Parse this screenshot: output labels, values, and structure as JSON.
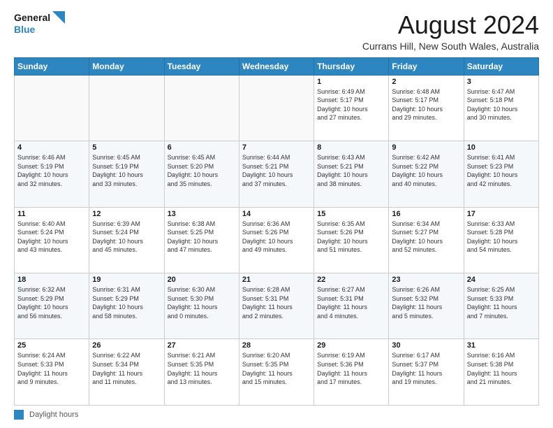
{
  "logo": {
    "line1": "General",
    "line2": "Blue"
  },
  "title": "August 2024",
  "subtitle": "Currans Hill, New South Wales, Australia",
  "days_of_week": [
    "Sunday",
    "Monday",
    "Tuesday",
    "Wednesday",
    "Thursday",
    "Friday",
    "Saturday"
  ],
  "footer": {
    "label": "Daylight hours"
  },
  "weeks": [
    [
      {
        "day": "",
        "info": ""
      },
      {
        "day": "",
        "info": ""
      },
      {
        "day": "",
        "info": ""
      },
      {
        "day": "",
        "info": ""
      },
      {
        "day": "1",
        "info": "Sunrise: 6:49 AM\nSunset: 5:17 PM\nDaylight: 10 hours\nand 27 minutes."
      },
      {
        "day": "2",
        "info": "Sunrise: 6:48 AM\nSunset: 5:17 PM\nDaylight: 10 hours\nand 29 minutes."
      },
      {
        "day": "3",
        "info": "Sunrise: 6:47 AM\nSunset: 5:18 PM\nDaylight: 10 hours\nand 30 minutes."
      }
    ],
    [
      {
        "day": "4",
        "info": "Sunrise: 6:46 AM\nSunset: 5:19 PM\nDaylight: 10 hours\nand 32 minutes."
      },
      {
        "day": "5",
        "info": "Sunrise: 6:45 AM\nSunset: 5:19 PM\nDaylight: 10 hours\nand 33 minutes."
      },
      {
        "day": "6",
        "info": "Sunrise: 6:45 AM\nSunset: 5:20 PM\nDaylight: 10 hours\nand 35 minutes."
      },
      {
        "day": "7",
        "info": "Sunrise: 6:44 AM\nSunset: 5:21 PM\nDaylight: 10 hours\nand 37 minutes."
      },
      {
        "day": "8",
        "info": "Sunrise: 6:43 AM\nSunset: 5:21 PM\nDaylight: 10 hours\nand 38 minutes."
      },
      {
        "day": "9",
        "info": "Sunrise: 6:42 AM\nSunset: 5:22 PM\nDaylight: 10 hours\nand 40 minutes."
      },
      {
        "day": "10",
        "info": "Sunrise: 6:41 AM\nSunset: 5:23 PM\nDaylight: 10 hours\nand 42 minutes."
      }
    ],
    [
      {
        "day": "11",
        "info": "Sunrise: 6:40 AM\nSunset: 5:24 PM\nDaylight: 10 hours\nand 43 minutes."
      },
      {
        "day": "12",
        "info": "Sunrise: 6:39 AM\nSunset: 5:24 PM\nDaylight: 10 hours\nand 45 minutes."
      },
      {
        "day": "13",
        "info": "Sunrise: 6:38 AM\nSunset: 5:25 PM\nDaylight: 10 hours\nand 47 minutes."
      },
      {
        "day": "14",
        "info": "Sunrise: 6:36 AM\nSunset: 5:26 PM\nDaylight: 10 hours\nand 49 minutes."
      },
      {
        "day": "15",
        "info": "Sunrise: 6:35 AM\nSunset: 5:26 PM\nDaylight: 10 hours\nand 51 minutes."
      },
      {
        "day": "16",
        "info": "Sunrise: 6:34 AM\nSunset: 5:27 PM\nDaylight: 10 hours\nand 52 minutes."
      },
      {
        "day": "17",
        "info": "Sunrise: 6:33 AM\nSunset: 5:28 PM\nDaylight: 10 hours\nand 54 minutes."
      }
    ],
    [
      {
        "day": "18",
        "info": "Sunrise: 6:32 AM\nSunset: 5:29 PM\nDaylight: 10 hours\nand 56 minutes."
      },
      {
        "day": "19",
        "info": "Sunrise: 6:31 AM\nSunset: 5:29 PM\nDaylight: 10 hours\nand 58 minutes."
      },
      {
        "day": "20",
        "info": "Sunrise: 6:30 AM\nSunset: 5:30 PM\nDaylight: 11 hours\nand 0 minutes."
      },
      {
        "day": "21",
        "info": "Sunrise: 6:28 AM\nSunset: 5:31 PM\nDaylight: 11 hours\nand 2 minutes."
      },
      {
        "day": "22",
        "info": "Sunrise: 6:27 AM\nSunset: 5:31 PM\nDaylight: 11 hours\nand 4 minutes."
      },
      {
        "day": "23",
        "info": "Sunrise: 6:26 AM\nSunset: 5:32 PM\nDaylight: 11 hours\nand 5 minutes."
      },
      {
        "day": "24",
        "info": "Sunrise: 6:25 AM\nSunset: 5:33 PM\nDaylight: 11 hours\nand 7 minutes."
      }
    ],
    [
      {
        "day": "25",
        "info": "Sunrise: 6:24 AM\nSunset: 5:33 PM\nDaylight: 11 hours\nand 9 minutes."
      },
      {
        "day": "26",
        "info": "Sunrise: 6:22 AM\nSunset: 5:34 PM\nDaylight: 11 hours\nand 11 minutes."
      },
      {
        "day": "27",
        "info": "Sunrise: 6:21 AM\nSunset: 5:35 PM\nDaylight: 11 hours\nand 13 minutes."
      },
      {
        "day": "28",
        "info": "Sunrise: 6:20 AM\nSunset: 5:35 PM\nDaylight: 11 hours\nand 15 minutes."
      },
      {
        "day": "29",
        "info": "Sunrise: 6:19 AM\nSunset: 5:36 PM\nDaylight: 11 hours\nand 17 minutes."
      },
      {
        "day": "30",
        "info": "Sunrise: 6:17 AM\nSunset: 5:37 PM\nDaylight: 11 hours\nand 19 minutes."
      },
      {
        "day": "31",
        "info": "Sunrise: 6:16 AM\nSunset: 5:38 PM\nDaylight: 11 hours\nand 21 minutes."
      }
    ]
  ]
}
